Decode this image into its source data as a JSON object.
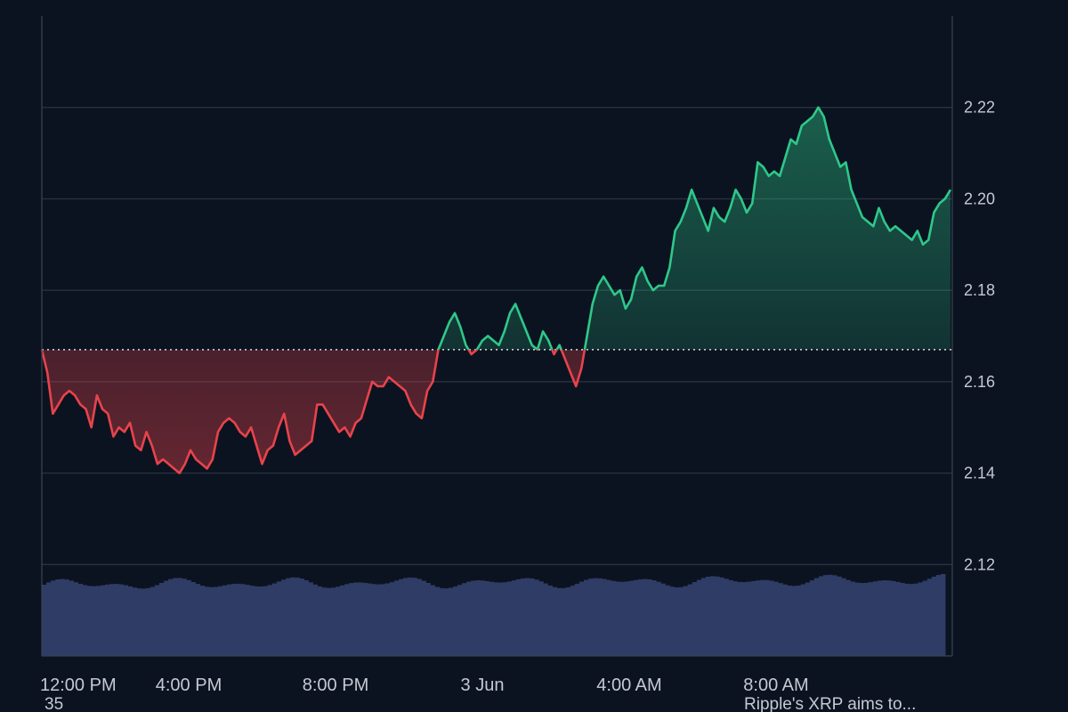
{
  "chart_data": {
    "type": "area",
    "x_ticks": [
      "12:00 PM",
      "4:00 PM",
      "8:00 PM",
      "3 Jun",
      "4:00 AM",
      "8:00 AM"
    ],
    "x_tick_hours": [
      0,
      4,
      8,
      12,
      16,
      20
    ],
    "y_ticks": [
      "2.12",
      "2.14",
      "2.16",
      "2.18",
      "2.20",
      "2.22"
    ],
    "ylim": [
      2.1,
      2.24
    ],
    "baseline": 2.167,
    "x_range_hours": [
      0,
      24.8
    ],
    "colors": {
      "background": "#0c1320",
      "above_baseline": "#2ec88a",
      "below_baseline": "#e8434b",
      "volume": "#2f3c66",
      "grid": "#2a3444"
    },
    "volume_level_fraction": 0.82,
    "price_series": [
      [
        0.0,
        2.167
      ],
      [
        0.15,
        2.162
      ],
      [
        0.3,
        2.153
      ],
      [
        0.45,
        2.155
      ],
      [
        0.6,
        2.157
      ],
      [
        0.75,
        2.158
      ],
      [
        0.9,
        2.157
      ],
      [
        1.05,
        2.155
      ],
      [
        1.2,
        2.154
      ],
      [
        1.35,
        2.15
      ],
      [
        1.5,
        2.157
      ],
      [
        1.65,
        2.154
      ],
      [
        1.8,
        2.153
      ],
      [
        1.95,
        2.148
      ],
      [
        2.1,
        2.15
      ],
      [
        2.25,
        2.149
      ],
      [
        2.4,
        2.151
      ],
      [
        2.55,
        2.146
      ],
      [
        2.7,
        2.145
      ],
      [
        2.85,
        2.149
      ],
      [
        3.0,
        2.146
      ],
      [
        3.15,
        2.142
      ],
      [
        3.3,
        2.143
      ],
      [
        3.45,
        2.142
      ],
      [
        3.6,
        2.141
      ],
      [
        3.75,
        2.14
      ],
      [
        3.9,
        2.142
      ],
      [
        4.05,
        2.145
      ],
      [
        4.2,
        2.143
      ],
      [
        4.35,
        2.142
      ],
      [
        4.5,
        2.141
      ],
      [
        4.65,
        2.143
      ],
      [
        4.8,
        2.149
      ],
      [
        4.95,
        2.151
      ],
      [
        5.1,
        2.152
      ],
      [
        5.25,
        2.151
      ],
      [
        5.4,
        2.149
      ],
      [
        5.55,
        2.148
      ],
      [
        5.7,
        2.15
      ],
      [
        5.85,
        2.146
      ],
      [
        6.0,
        2.142
      ],
      [
        6.15,
        2.145
      ],
      [
        6.3,
        2.146
      ],
      [
        6.45,
        2.15
      ],
      [
        6.6,
        2.153
      ],
      [
        6.75,
        2.147
      ],
      [
        6.9,
        2.144
      ],
      [
        7.05,
        2.145
      ],
      [
        7.2,
        2.146
      ],
      [
        7.35,
        2.147
      ],
      [
        7.5,
        2.155
      ],
      [
        7.65,
        2.155
      ],
      [
        7.8,
        2.153
      ],
      [
        7.95,
        2.151
      ],
      [
        8.1,
        2.149
      ],
      [
        8.25,
        2.15
      ],
      [
        8.4,
        2.148
      ],
      [
        8.55,
        2.151
      ],
      [
        8.7,
        2.152
      ],
      [
        8.85,
        2.156
      ],
      [
        9.0,
        2.16
      ],
      [
        9.15,
        2.159
      ],
      [
        9.3,
        2.159
      ],
      [
        9.45,
        2.161
      ],
      [
        9.6,
        2.16
      ],
      [
        9.75,
        2.159
      ],
      [
        9.9,
        2.158
      ],
      [
        10.05,
        2.155
      ],
      [
        10.2,
        2.153
      ],
      [
        10.35,
        2.152
      ],
      [
        10.5,
        2.158
      ],
      [
        10.65,
        2.16
      ],
      [
        10.8,
        2.167
      ],
      [
        10.95,
        2.17
      ],
      [
        11.1,
        2.173
      ],
      [
        11.25,
        2.175
      ],
      [
        11.4,
        2.172
      ],
      [
        11.55,
        2.168
      ],
      [
        11.7,
        2.166
      ],
      [
        11.85,
        2.167
      ],
      [
        12.0,
        2.169
      ],
      [
        12.15,
        2.17
      ],
      [
        12.3,
        2.169
      ],
      [
        12.45,
        2.168
      ],
      [
        12.6,
        2.171
      ],
      [
        12.75,
        2.175
      ],
      [
        12.9,
        2.177
      ],
      [
        13.05,
        2.174
      ],
      [
        13.2,
        2.171
      ],
      [
        13.35,
        2.168
      ],
      [
        13.5,
        2.167
      ],
      [
        13.65,
        2.171
      ],
      [
        13.8,
        2.169
      ],
      [
        13.95,
        2.166
      ],
      [
        14.1,
        2.168
      ],
      [
        14.25,
        2.165
      ],
      [
        14.4,
        2.162
      ],
      [
        14.55,
        2.159
      ],
      [
        14.7,
        2.163
      ],
      [
        14.85,
        2.17
      ],
      [
        15.0,
        2.177
      ],
      [
        15.15,
        2.181
      ],
      [
        15.3,
        2.183
      ],
      [
        15.45,
        2.181
      ],
      [
        15.6,
        2.179
      ],
      [
        15.75,
        2.18
      ],
      [
        15.9,
        2.176
      ],
      [
        16.05,
        2.178
      ],
      [
        16.2,
        2.183
      ],
      [
        16.35,
        2.185
      ],
      [
        16.5,
        2.182
      ],
      [
        16.65,
        2.18
      ],
      [
        16.8,
        2.181
      ],
      [
        16.95,
        2.181
      ],
      [
        17.1,
        2.185
      ],
      [
        17.25,
        2.193
      ],
      [
        17.4,
        2.195
      ],
      [
        17.55,
        2.198
      ],
      [
        17.7,
        2.202
      ],
      [
        17.85,
        2.199
      ],
      [
        18.0,
        2.196
      ],
      [
        18.15,
        2.193
      ],
      [
        18.3,
        2.198
      ],
      [
        18.45,
        2.196
      ],
      [
        18.6,
        2.195
      ],
      [
        18.75,
        2.198
      ],
      [
        18.9,
        2.202
      ],
      [
        19.05,
        2.2
      ],
      [
        19.2,
        2.197
      ],
      [
        19.35,
        2.199
      ],
      [
        19.5,
        2.208
      ],
      [
        19.65,
        2.207
      ],
      [
        19.8,
        2.205
      ],
      [
        19.95,
        2.206
      ],
      [
        20.1,
        2.205
      ],
      [
        20.25,
        2.209
      ],
      [
        20.4,
        2.213
      ],
      [
        20.55,
        2.212
      ],
      [
        20.7,
        2.216
      ],
      [
        20.85,
        2.217
      ],
      [
        21.0,
        2.218
      ],
      [
        21.15,
        2.22
      ],
      [
        21.3,
        2.218
      ],
      [
        21.45,
        2.213
      ],
      [
        21.6,
        2.21
      ],
      [
        21.75,
        2.207
      ],
      [
        21.9,
        2.208
      ],
      [
        22.05,
        2.202
      ],
      [
        22.2,
        2.199
      ],
      [
        22.35,
        2.196
      ],
      [
        22.5,
        2.195
      ],
      [
        22.65,
        2.194
      ],
      [
        22.8,
        2.198
      ],
      [
        22.95,
        2.195
      ],
      [
        23.1,
        2.193
      ],
      [
        23.25,
        2.194
      ],
      [
        23.4,
        2.193
      ],
      [
        23.55,
        2.192
      ],
      [
        23.7,
        2.191
      ],
      [
        23.85,
        2.193
      ],
      [
        24.0,
        2.19
      ],
      [
        24.15,
        2.191
      ],
      [
        24.3,
        2.197
      ],
      [
        24.45,
        2.199
      ],
      [
        24.6,
        2.2
      ],
      [
        24.75,
        2.202
      ]
    ]
  },
  "footer": {
    "left": "35",
    "right": "Ripple's XRP aims to..."
  }
}
